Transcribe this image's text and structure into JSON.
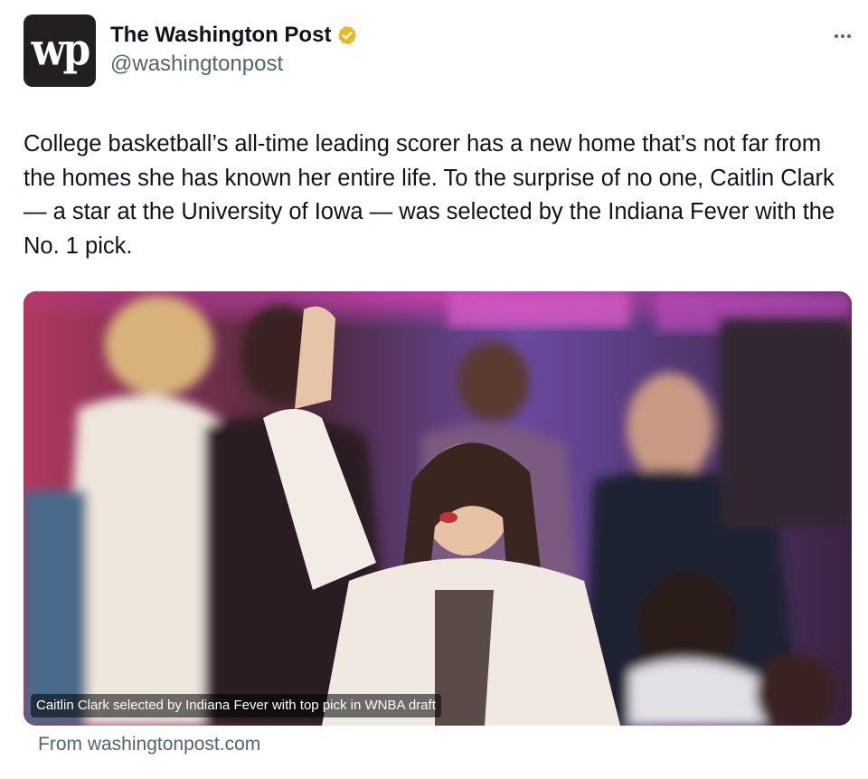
{
  "author": {
    "name": "The Washington Post",
    "handle": "@washingtonpost",
    "avatar_mark": "wp",
    "verified": true,
    "verified_color": "#e8b923"
  },
  "tweet": {
    "text": "College basketball’s all-time leading scorer has a new home that’s not far from the homes she has known her entire life. To the surprise of no one, Caitlin Clark — a star at the University of Iowa — was selected by the Indiana Fever with the No. 1 pick."
  },
  "card": {
    "caption": "Caitlin Clark selected by Indiana Fever with top pick in WNBA draft",
    "source": "From washingtonpost.com"
  },
  "icons": {
    "more": "more-options-icon",
    "verified": "verified-badge-icon"
  },
  "colors": {
    "text": "#0f1419",
    "secondary": "#536471",
    "stage_magenta": "#c83fae",
    "stage_purple": "#7a3f9e"
  }
}
